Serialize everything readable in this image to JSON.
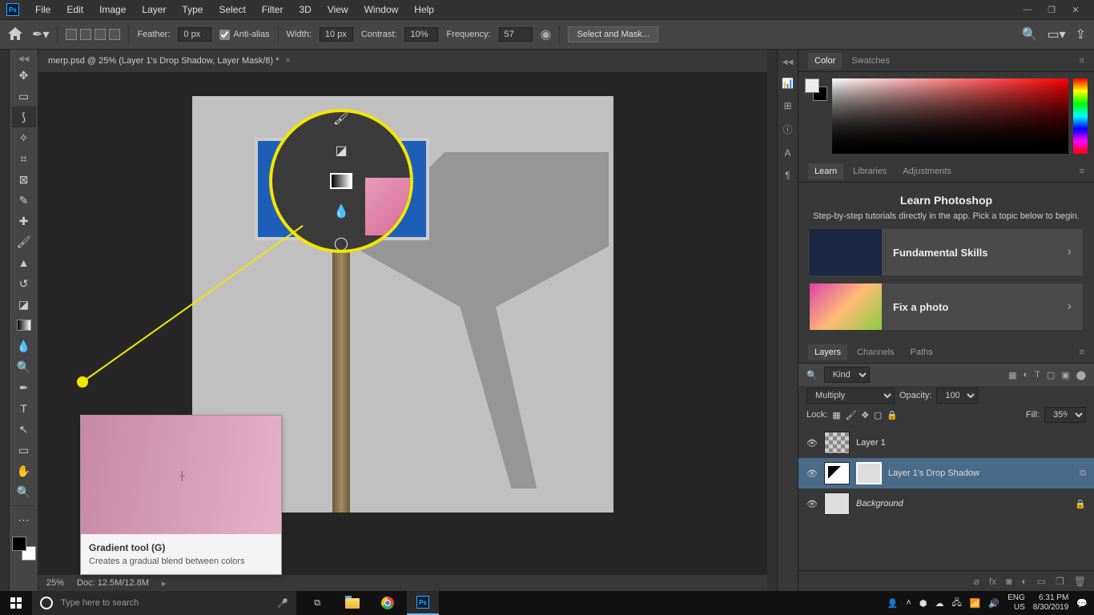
{
  "menu": [
    "File",
    "Edit",
    "Image",
    "Layer",
    "Type",
    "Select",
    "Filter",
    "3D",
    "View",
    "Window",
    "Help"
  ],
  "options": {
    "feather_label": "Feather:",
    "feather_val": "0 px",
    "antialias": "Anti-alias",
    "width_label": "Width:",
    "width_val": "10 px",
    "contrast_label": "Contrast:",
    "contrast_val": "10%",
    "frequency_label": "Frequency:",
    "frequency_val": "57",
    "select_mask": "Select and Mask..."
  },
  "doc_tab": "merp.psd @ 25% (Layer 1's Drop Shadow, Layer Mask/8) *",
  "tooltip": {
    "title": "Gradient tool (G)",
    "desc": "Creates a gradual blend between colors"
  },
  "status": {
    "zoom": "25%",
    "doc": "Doc: 12.5M/12.8M"
  },
  "color_tabs": [
    "Color",
    "Swatches"
  ],
  "learn_tabs": [
    "Learn",
    "Libraries",
    "Adjustments"
  ],
  "learn": {
    "title": "Learn Photoshop",
    "sub": "Step-by-step tutorials directly in the app. Pick a topic below to begin.",
    "item1": "Fundamental Skills",
    "item2": "Fix a photo"
  },
  "layer_tabs": [
    "Layers",
    "Channels",
    "Paths"
  ],
  "layers": {
    "kind": "Kind",
    "blend": "Multiply",
    "opacity_label": "Opacity:",
    "opacity": "100%",
    "lock_label": "Lock:",
    "fill_label": "Fill:",
    "fill": "35%",
    "items": [
      {
        "name": "Layer 1"
      },
      {
        "name": "Layer 1's Drop Shadow"
      },
      {
        "name": "Background"
      }
    ]
  },
  "taskbar": {
    "search_placeholder": "Type here to search",
    "lang": "ENG",
    "locale": "US",
    "time": "6:31 PM",
    "date": "8/30/2019"
  }
}
